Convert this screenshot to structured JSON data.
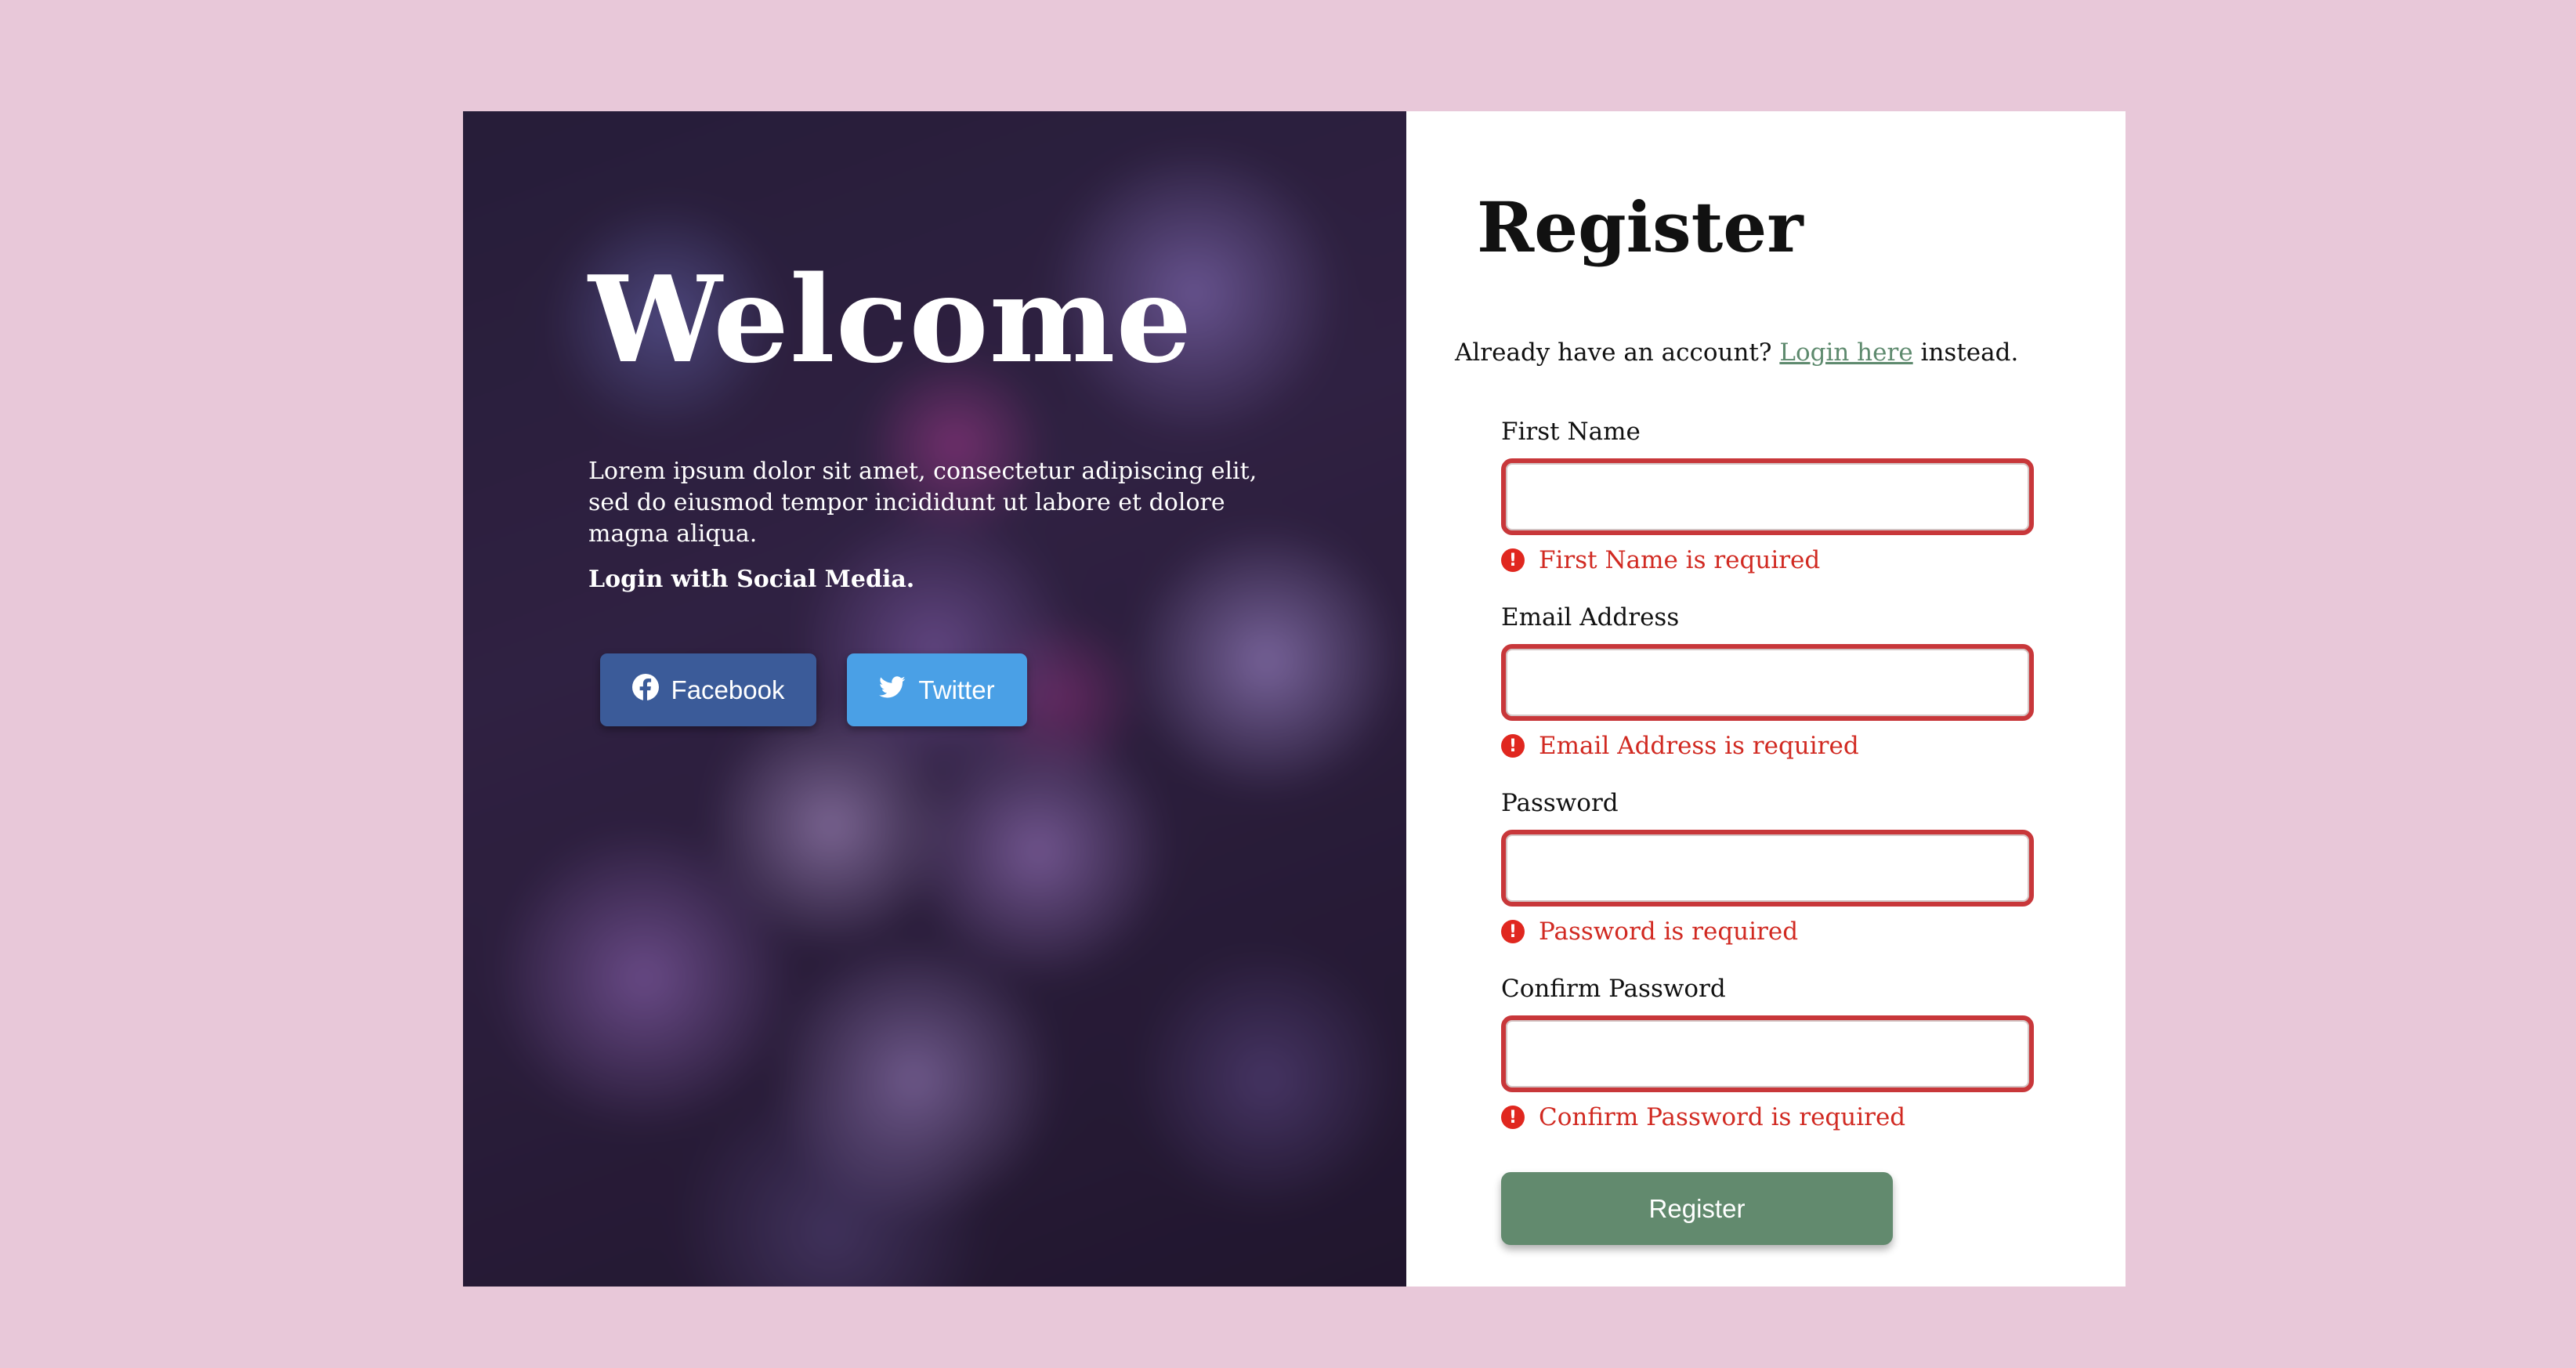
{
  "colors": {
    "page_background": "#e8c8d9",
    "panel_background": "#ffffff",
    "link": "#5e8a6e",
    "error": "#d12a22",
    "input_border_error": "#c8373a",
    "facebook": "#3b5b99",
    "twitter": "#4aa0e6",
    "primary_button": "#628a6e"
  },
  "hero": {
    "title": "Welcome",
    "description": "Lorem ipsum dolor sit amet, consectetur adipiscing elit, sed do eiusmod tempor incididunt ut labore et dolore magna aliqua.",
    "social_prompt": "Login with Social Media.",
    "buttons": {
      "facebook": {
        "label": "Facebook",
        "icon": "facebook-icon"
      },
      "twitter": {
        "label": "Twitter",
        "icon": "twitter-icon"
      }
    }
  },
  "register": {
    "title": "Register",
    "account_prefix": "Already have an account?",
    "login_link": "Login here",
    "account_suffix": "instead.",
    "fields": [
      {
        "label": "First Name",
        "value": "",
        "error": "First Name is required"
      },
      {
        "label": "Email Address",
        "value": "",
        "error": "Email Address is required"
      },
      {
        "label": "Password",
        "value": "",
        "error": "Password is required"
      },
      {
        "label": "Confirm Password",
        "value": "",
        "error": "Confirm Password is required"
      }
    ],
    "error_icon": "exclamation-circle-icon",
    "error_icon_glyph": "!",
    "submit_label": "Register"
  }
}
